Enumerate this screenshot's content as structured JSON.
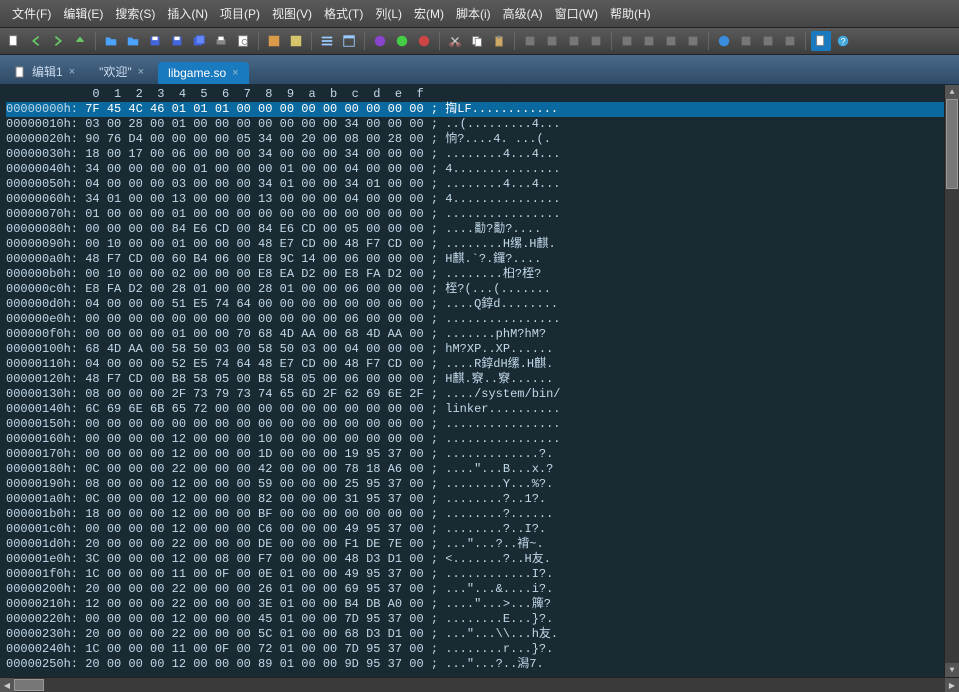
{
  "menu": {
    "items": [
      "文件(F)",
      "编辑(E)",
      "搜索(S)",
      "插入(N)",
      "项目(P)",
      "视图(V)",
      "格式(T)",
      "列(L)",
      "宏(M)",
      "脚本(i)",
      "高级(A)",
      "窗口(W)",
      "帮助(H)"
    ]
  },
  "tabs": [
    {
      "label": "编辑1",
      "active": false,
      "icon": "file-new"
    },
    {
      "label": "\"欢迎\"",
      "active": false,
      "icon": ""
    },
    {
      "label": "libgame.so",
      "active": true,
      "icon": ""
    }
  ],
  "ruler": "            0  1  2  3  4  5  6  7  8  9  a  b  c  d  e  f",
  "hex_rows": [
    {
      "addr": "00000000h:",
      "bytes": "7F 45 4C 46 01 01 01 00 00 00 00 00 00 00 00 00",
      "ascii": "; 揈LF............",
      "hl": true
    },
    {
      "addr": "00000010h:",
      "bytes": "03 00 28 00 01 00 00 00 00 00 00 00 34 00 00 00",
      "ascii": "; ..(.........4..."
    },
    {
      "addr": "00000020h:",
      "bytes": "90 76 D4 00 00 00 00 05 34 00 20 00 08 00 28 00",
      "ascii": "; 恦?....4. ...(."
    },
    {
      "addr": "00000030h:",
      "bytes": "18 00 17 00 06 00 00 00 34 00 00 00 34 00 00 00",
      "ascii": "; ........4...4..."
    },
    {
      "addr": "00000040h:",
      "bytes": "34 00 00 00 00 01 00 00 00 01 00 00 04 00 00 00",
      "ascii": "; 4..............."
    },
    {
      "addr": "00000050h:",
      "bytes": "04 00 00 00 03 00 00 00 34 01 00 00 34 01 00 00",
      "ascii": "; ........4...4..."
    },
    {
      "addr": "00000060h:",
      "bytes": "34 01 00 00 13 00 00 00 13 00 00 00 04 00 00 00",
      "ascii": "; 4..............."
    },
    {
      "addr": "00000070h:",
      "bytes": "01 00 00 00 01 00 00 00 00 00 00 00 00 00 00 00",
      "ascii": "; ................"
    },
    {
      "addr": "00000080h:",
      "bytes": "00 00 00 00 84 E6 CD 00 84 E6 CD 00 05 00 00 00",
      "ascii": "; ....勫?勫?...."
    },
    {
      "addr": "00000090h:",
      "bytes": "00 10 00 00 01 00 00 00 48 E7 CD 00 48 F7 CD 00",
      "ascii": "; ........H缧.H麒."
    },
    {
      "addr": "000000a0h:",
      "bytes": "48 F7 CD 00 60 B4 06 00 E8 9C 14 00 06 00 00 00",
      "ascii": "; H麒.`?.鑼?...."
    },
    {
      "addr": "000000b0h:",
      "bytes": "00 10 00 00 02 00 00 00 E8 EA D2 00 E8 FA D2 00",
      "ascii": "; ........桕?桎?"
    },
    {
      "addr": "000000c0h:",
      "bytes": "E8 FA D2 00 28 01 00 00 28 01 00 00 06 00 00 00",
      "ascii": "; 桎?(...(......."
    },
    {
      "addr": "000000d0h:",
      "bytes": "04 00 00 00 51 E5 74 64 00 00 00 00 00 00 00 00",
      "ascii": "; ....Q錞d........"
    },
    {
      "addr": "000000e0h:",
      "bytes": "00 00 00 00 00 00 00 00 00 00 00 00 06 00 00 00",
      "ascii": "; ................"
    },
    {
      "addr": "000000f0h:",
      "bytes": "00 00 00 00 01 00 00 70 68 4D AA 00 68 4D AA 00",
      "ascii": "; .......phM?hM?"
    },
    {
      "addr": "00000100h:",
      "bytes": "68 4D AA 00 58 50 03 00 58 50 03 00 04 00 00 00",
      "ascii": "; hM?XP..XP......"
    },
    {
      "addr": "00000110h:",
      "bytes": "04 00 00 00 52 E5 74 64 48 E7 CD 00 48 F7 CD 00",
      "ascii": "; ....R錞dH缧.H麒."
    },
    {
      "addr": "00000120h:",
      "bytes": "48 F7 CD 00 B8 58 05 00 B8 58 05 00 06 00 00 00",
      "ascii": "; H麒.竂..竂......"
    },
    {
      "addr": "00000130h:",
      "bytes": "08 00 00 00 2F 73 79 73 74 65 6D 2F 62 69 6E 2F",
      "ascii": "; ..../system/bin/"
    },
    {
      "addr": "00000140h:",
      "bytes": "6C 69 6E 6B 65 72 00 00 00 00 00 00 00 00 00 00",
      "ascii": "; linker.........."
    },
    {
      "addr": "00000150h:",
      "bytes": "00 00 00 00 00 00 00 00 00 00 00 00 00 00 00 00",
      "ascii": "; ................"
    },
    {
      "addr": "00000160h:",
      "bytes": "00 00 00 00 12 00 00 00 10 00 00 00 00 00 00 00",
      "ascii": "; ................"
    },
    {
      "addr": "00000170h:",
      "bytes": "00 00 00 00 12 00 00 00 1D 00 00 00 19 95 37 00",
      "ascii": "; .............?."
    },
    {
      "addr": "00000180h:",
      "bytes": "0C 00 00 00 22 00 00 00 42 00 00 00 78 18 A6 00",
      "ascii": "; ....\"...B...x.?"
    },
    {
      "addr": "00000190h:",
      "bytes": "08 00 00 00 12 00 00 00 59 00 00 00 25 95 37 00",
      "ascii": "; ........Y...%?."
    },
    {
      "addr": "000001a0h:",
      "bytes": "0C 00 00 00 12 00 00 00 82 00 00 00 31 95 37 00",
      "ascii": "; ........?..1?."
    },
    {
      "addr": "000001b0h:",
      "bytes": "18 00 00 00 12 00 00 00 BF 00 00 00 00 00 00 00",
      "ascii": "; ........?......"
    },
    {
      "addr": "000001c0h:",
      "bytes": "00 00 00 00 12 00 00 00 C6 00 00 00 49 95 37 00",
      "ascii": "; ........?..I?."
    },
    {
      "addr": "000001d0h:",
      "bytes": "20 00 00 00 22 00 00 00 DE 00 00 00 F1 DE 7E 00",
      "ascii": "; ...\"...?..褙~."
    },
    {
      "addr": "000001e0h:",
      "bytes": "3C 00 00 00 12 00 08 00 F7 00 00 00 48 D3 D1 00",
      "ascii": "; <.......?..H友."
    },
    {
      "addr": "000001f0h:",
      "bytes": "1C 00 00 00 11 00 0F 00 0E 01 00 00 49 95 37 00",
      "ascii": "; ............I?."
    },
    {
      "addr": "00000200h:",
      "bytes": "20 00 00 00 22 00 00 00 26 01 00 00 69 95 37 00",
      "ascii": "; ...\"...&....i?."
    },
    {
      "addr": "00000210h:",
      "bytes": "12 00 00 00 22 00 00 00 3E 01 00 00 B4 DB A0 00",
      "ascii": "; ....\"...>...簰?"
    },
    {
      "addr": "00000220h:",
      "bytes": "00 00 00 00 12 00 00 00 45 01 00 00 7D 95 37 00",
      "ascii": "; ........E...}?."
    },
    {
      "addr": "00000230h:",
      "bytes": "20 00 00 00 22 00 00 00 5C 01 00 00 68 D3 D1 00",
      "ascii": "; ...\"...\\\\...h友."
    },
    {
      "addr": "00000240h:",
      "bytes": "1C 00 00 00 11 00 0F 00 72 01 00 00 7D 95 37 00",
      "ascii": "; ........r...}?."
    },
    {
      "addr": "00000250h:",
      "bytes": "20 00 00 00 12 00 00 00 89 01 00 00 9D 95 37 00",
      "ascii": "; ...\"...?..潟7."
    }
  ]
}
